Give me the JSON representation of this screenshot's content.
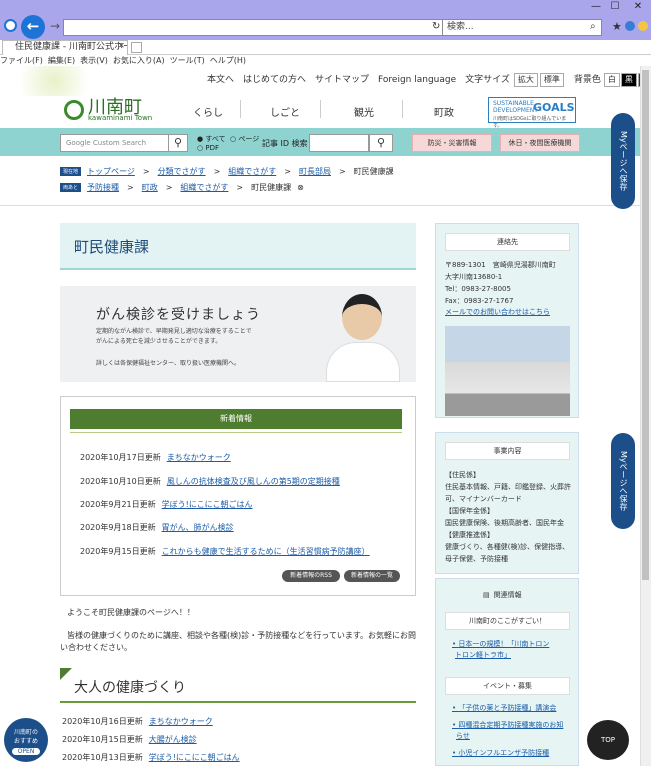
{
  "browser": {
    "address": "",
    "search_placeholder": "検索...",
    "tab_title": "住民健康課 - 川南町公式ホー...",
    "menu": [
      "ファイル(F)",
      "編集(E)",
      "表示(V)",
      "お気に入り(A)",
      "ツール(T)",
      "ヘルプ(H)"
    ]
  },
  "header": {
    "topnav": [
      "本文へ",
      "はじめての方へ",
      "サイトマップ",
      "Foreign language",
      "文字サイズ"
    ],
    "fontsize_large": "拡大",
    "fontsize_standard": "標準",
    "bgcolor_label": "背景色",
    "bg_white": "白",
    "bg_black": "黒",
    "bg_blue": "青",
    "logo_name": "川南町",
    "logo_sub": "kawaminami Town",
    "mainnav": [
      "くらし",
      "しごと",
      "観光",
      "町政"
    ],
    "sdg_t1": "SUSTAINABLE DEVELOPMENT",
    "sdg_t2": "GOALS",
    "sdg_t3": "川南町はSDGsに取り組んでいます。"
  },
  "search": {
    "placeholder": "Google Custom Search",
    "opt_all": "すべて",
    "opt_page": "ページ",
    "opt_pdf": "PDF",
    "id_label": "記事 ID 検索",
    "disaster": "防災・災害情報",
    "holiday": "休日・夜間医療機関"
  },
  "breadcrumb1": {
    "tag": "現在地",
    "items": [
      "トップページ",
      "分類でさがす",
      "組織でさがす",
      "町長部局"
    ],
    "current": "町民健康課"
  },
  "breadcrumb2": {
    "tag": "両あと",
    "items": [
      "予防接種",
      "町政",
      "組織でさがす"
    ],
    "current": "町民健康課"
  },
  "main": {
    "title": "町民健康課",
    "banner_title": "がん検診を受けましょう",
    "banner_l1": "定期的ながん検診で、早期発見し適切な治療をすることで",
    "banner_l2": "がんによる死亡を減少させることができます。",
    "banner_l3": "詳しくは各保健福祉センター、取り扱い医療機関へ。",
    "news_title": "新着情報",
    "news": [
      {
        "date": "2020年10月17日更新",
        "title": "まちなかウォーク"
      },
      {
        "date": "2020年10月10日更新",
        "title": "風しんの抗体検査及び風しんの第5期の定期接種"
      },
      {
        "date": "2020年9月21日更新",
        "title": "学ぼう!にこにこ朝ごはん"
      },
      {
        "date": "2020年9月18日更新",
        "title": "胃がん、肺がん検診"
      },
      {
        "date": "2020年9月15日更新",
        "title": "これからも健康で生活するために（生活習慣病予防講座）"
      }
    ],
    "rss": "新着情報のRSS",
    "news_list": "新着情報の一覧",
    "greet1": "ようこそ町民健康課のページへ！！",
    "greet2": "皆様の健康づくりのために講座、相談や各種(検)診・予防接種などを行っています。お気軽にお問",
    "greet3": "い合わせください。",
    "section2": "大人の健康づくり",
    "adult": [
      {
        "date": "2020年10月16日更新",
        "title": "まちなかウォーク"
      },
      {
        "date": "2020年10月15日更新",
        "title": "大腸がん検診"
      },
      {
        "date": "2020年10月13日更新",
        "title": "学ぼう!にこにこ朝ごはん"
      }
    ]
  },
  "side": {
    "contact_title": "連絡先",
    "contact": [
      "〒889-1301　宮崎県児湯郡川南町",
      "大字川南13680-1",
      "Tel：0983-27-8005",
      "Fax：0983-27-1767"
    ],
    "contact_link": "メールでのお問い合わせはこちら",
    "biz_title": "事業内容",
    "biz": [
      "【住民係】",
      "住民基本情報、戸籍、印鑑登録、火葬許",
      "可、マイナンバーカード",
      "【国保年金係】",
      "国民健康保険、後期高齢者、国民年金",
      "【健康推進係】",
      "健康づくり、各種健(検)診、保健指導、",
      "母子保健、予防接種"
    ],
    "rel_title": "関連情報",
    "rel_sub": "川南町のここがすごい！",
    "rel_link1a": "日本一の規模！「川南トロン",
    "rel_link1b": "トロン軽トラ市」",
    "event_title": "イベント・募集",
    "event1": "「子供の薬と予防接種」講演会",
    "event2a": "四種混合定期予防接種実施のお知",
    "event2b": "らせ",
    "event3": "小児インフルエンザ予防接種",
    "mypage": "Myページへ保存"
  },
  "floating": {
    "osusume1": "川南町の",
    "osusume2": "おすすめ",
    "osusume3": "OPEN",
    "top": "TOP"
  }
}
